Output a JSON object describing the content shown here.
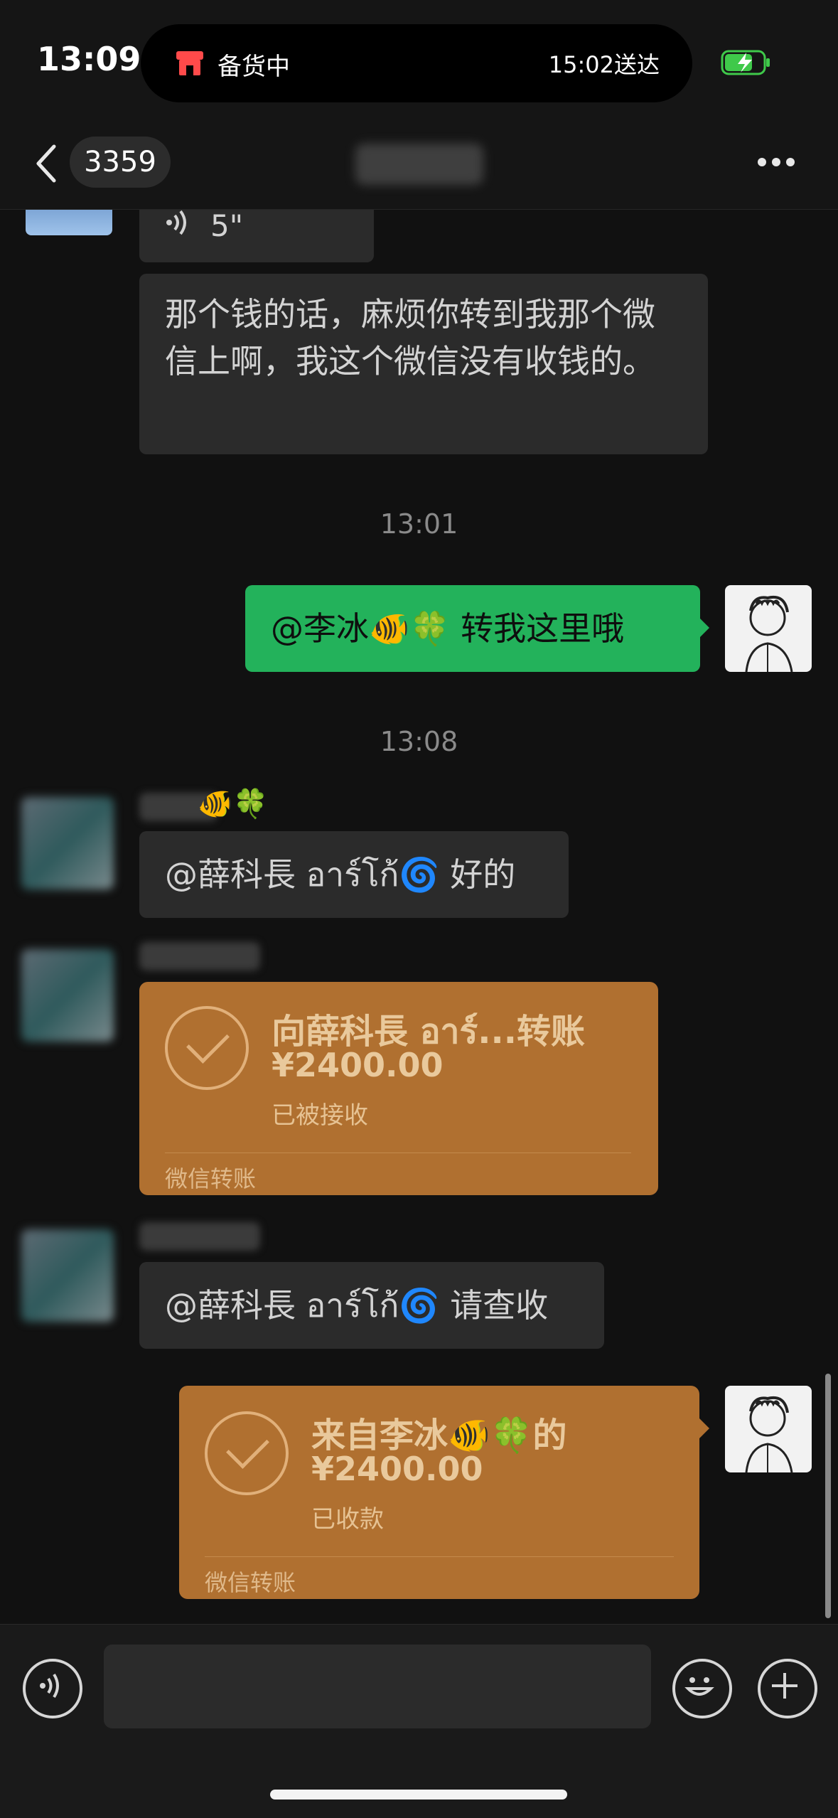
{
  "status_bar": {
    "time": "13:09",
    "activity_label": "备货中",
    "activity_eta": "15:02送达",
    "activity_icon": "store-icon",
    "battery_icon": "battery-charging-icon"
  },
  "nav": {
    "unread_count": "3359",
    "back_icon": "chevron-left-icon",
    "more_icon": "more-dots-icon"
  },
  "messages": {
    "voice_duration": "5\"",
    "text1": "那个钱的话，麻烦你转到我那个微信上啊，我这个微信没有收钱的。",
    "time1": "13:01",
    "my_msg": "@李冰🐠🍀 转我这里哦",
    "time2": "13:08",
    "reply1": "@薛科長 อาร์โก้🌀 好的",
    "transfer1": {
      "title": "向薛科長 อาร์...转账",
      "amount": "¥2400.00",
      "status": "已被接收",
      "footer": "微信转账"
    },
    "reply2": "@薛科長 อาร์โก้🌀 请查收",
    "transfer2": {
      "title": "来自李冰🐠🍀的",
      "amount": "¥2400.00",
      "status": "已收款",
      "footer": "微信转账"
    },
    "name_emoji": "🐠🍀"
  },
  "input": {
    "voice_icon": "voice-icon",
    "emoji_icon": "emoji-icon",
    "add_icon": "plus-icon"
  }
}
